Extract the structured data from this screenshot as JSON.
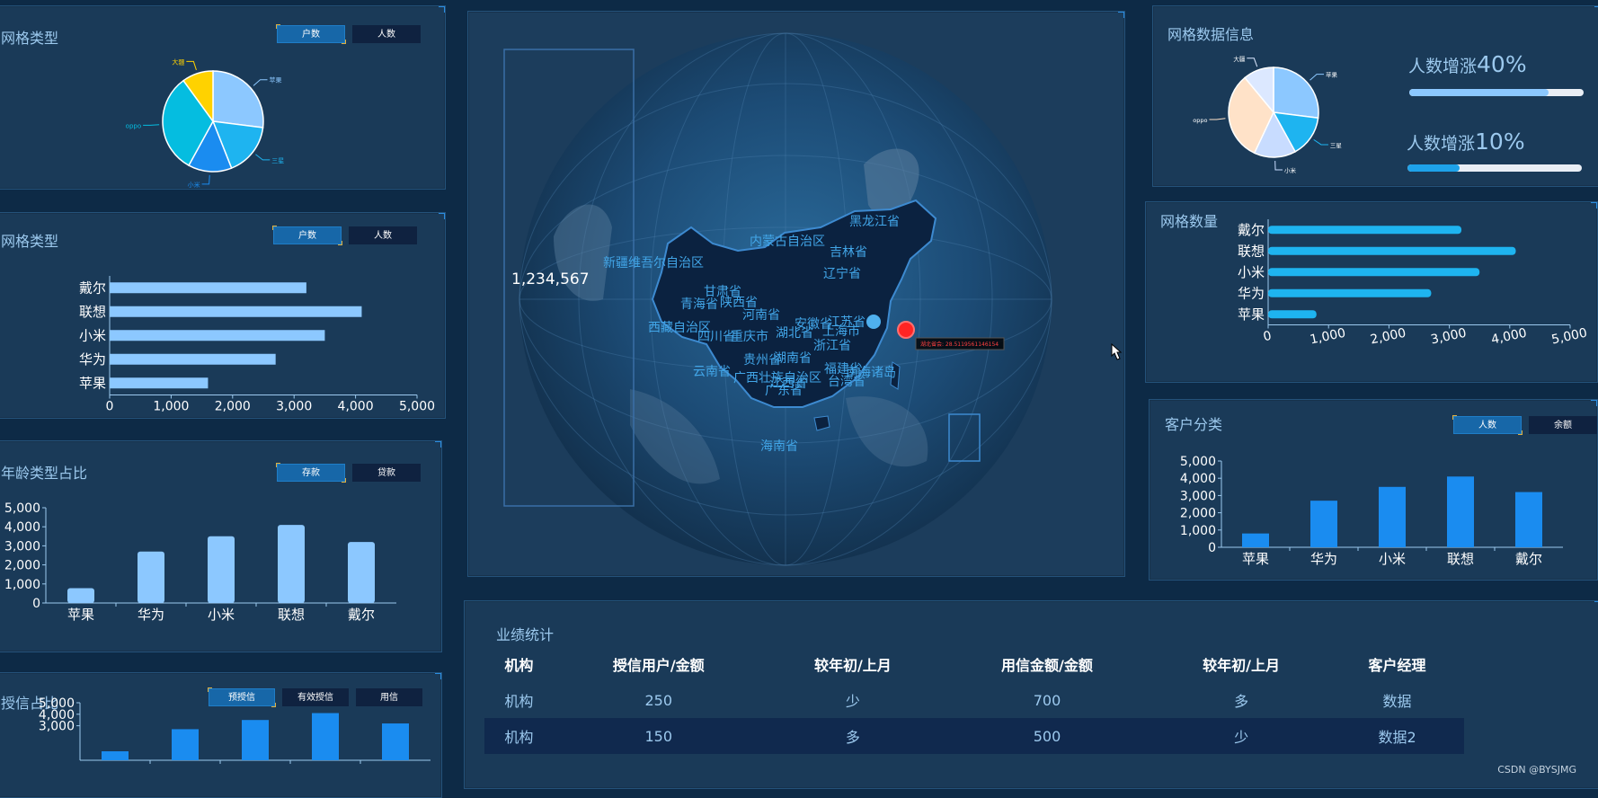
{
  "panels": {
    "grid_type_pie": {
      "title": "网格类型",
      "tabs": [
        "户数",
        "人数"
      ]
    },
    "grid_type_bar": {
      "title": "网格类型",
      "tabs": [
        "户数",
        "人数"
      ]
    },
    "age_type": {
      "title": "年龄类型占比",
      "tabs": [
        "存款",
        "贷款"
      ]
    },
    "credit_ratio": {
      "title": "授信占比",
      "tabs": [
        "预授信",
        "有效授信",
        "用信"
      ]
    },
    "grid_data_info": {
      "title": "网格数据信息"
    },
    "grid_count": {
      "title": "网格数量"
    },
    "customer_class": {
      "title": "客户分类",
      "tabs": [
        "人数",
        "余额"
      ]
    },
    "performance": {
      "title": "业绩统计"
    }
  },
  "map": {
    "counter": "1,234,567",
    "tooltip": "湖北省会: 28.5119561146154",
    "provinces": [
      "新疆维吾尔自治区",
      "西藏自治区",
      "青海省",
      "甘肃省",
      "内蒙古自治区",
      "黑龙江省",
      "吉林省",
      "辽宁省",
      "陕西省",
      "河南省",
      "湖北省",
      "四川省",
      "重庆市",
      "贵州省",
      "湖南省",
      "云南省",
      "广西壮族自治区",
      "江西省",
      "浙江省",
      "上海市",
      "江苏省",
      "安徽省",
      "福建省",
      "台湾省",
      "广东省",
      "海南省",
      "南海诸岛"
    ]
  },
  "stats": [
    {
      "label": "人数增涨",
      "value": "40%",
      "fill": 0.8,
      "color": "#8cc8ff"
    },
    {
      "label": "人数增涨",
      "value": "10%",
      "fill": 0.3,
      "color": "#1ea2ea"
    }
  ],
  "table": {
    "headers": [
      "机构",
      "授信用户/金额",
      "较年初/上月",
      "用信金额/金额",
      "较年初/上月",
      "客户经理"
    ],
    "rows": [
      [
        "机构",
        "250",
        "少",
        "700",
        "多",
        "数据"
      ],
      [
        "机构",
        "150",
        "多",
        "500",
        "少",
        "数据2"
      ]
    ]
  },
  "watermark": "CSDN @BYSJMG",
  "chart_data": [
    {
      "id": "pie-left",
      "type": "pie",
      "labels": [
        "苹果",
        "三星",
        "小米",
        "oppo",
        "大疆"
      ],
      "values": [
        27,
        17,
        14,
        32,
        10
      ],
      "colors": [
        "#8cc8ff",
        "#1eb4f0",
        "#1a8cf0",
        "#05bde0",
        "#ffd200"
      ]
    },
    {
      "id": "hbar-left",
      "type": "bar",
      "orientation": "horizontal",
      "categories": [
        "戴尔",
        "联想",
        "小米",
        "华为",
        "苹果"
      ],
      "values": [
        3200,
        4100,
        3500,
        2700,
        1600
      ],
      "xlim": [
        0,
        5000
      ],
      "ticks": [
        0,
        1000,
        2000,
        3000,
        4000,
        5000
      ],
      "color": "#8cc8ff"
    },
    {
      "id": "vbar-age",
      "type": "bar",
      "categories": [
        "苹果",
        "华为",
        "小米",
        "联想",
        "戴尔"
      ],
      "values": [
        780,
        2700,
        3500,
        4100,
        3200
      ],
      "ylim": [
        0,
        5000
      ],
      "ticks": [
        0,
        1000,
        2000,
        3000,
        4000,
        5000
      ],
      "color": "#8cc8ff"
    },
    {
      "id": "vbar-credit",
      "type": "bar",
      "categories": [
        "苹果",
        "华为",
        "小米",
        "联想",
        "戴尔"
      ],
      "values": [
        780,
        2700,
        3500,
        4100,
        3200
      ],
      "ylim": [
        0,
        5000
      ],
      "ticks": [
        3000,
        4000,
        5000
      ],
      "color": "#1a8cf0"
    },
    {
      "id": "pie-right",
      "type": "pie",
      "labels": [
        "苹果",
        "三星",
        "小米",
        "oppo",
        "大疆"
      ],
      "values": [
        27,
        15,
        15,
        32,
        11
      ],
      "colors": [
        "#8cc8ff",
        "#1eb4f0",
        "#c8dcff",
        "#ffe2c8",
        "#dce8ff"
      ]
    },
    {
      "id": "hbar-right",
      "type": "bar",
      "orientation": "horizontal",
      "categories": [
        "戴尔",
        "联想",
        "小米",
        "华为",
        "苹果"
      ],
      "values": [
        3200,
        4100,
        3500,
        2700,
        800
      ],
      "xlim": [
        0,
        5000
      ],
      "ticks": [
        0,
        1000,
        2000,
        3000,
        4000,
        5000
      ],
      "color": "#1eb4f0"
    },
    {
      "id": "vbar-customer",
      "type": "bar",
      "categories": [
        "苹果",
        "华为",
        "小米",
        "联想",
        "戴尔"
      ],
      "values": [
        800,
        2700,
        3500,
        4100,
        3200
      ],
      "ylim": [
        0,
        5000
      ],
      "ticks": [
        0,
        1000,
        2000,
        3000,
        4000,
        5000
      ],
      "color": "#1a8cf0"
    }
  ]
}
